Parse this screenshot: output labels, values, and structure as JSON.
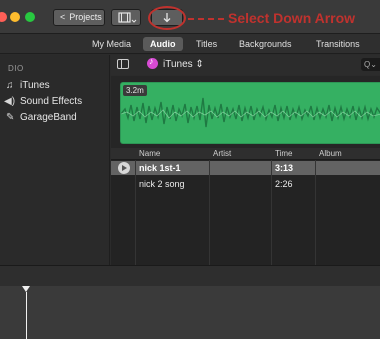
{
  "toolbar": {
    "projects_label": "Projects",
    "annotation_text": "Select Down Arrow"
  },
  "tabs": [
    {
      "label": "My Media"
    },
    {
      "label": "Audio"
    },
    {
      "label": "Titles"
    },
    {
      "label": "Backgrounds"
    },
    {
      "label": "Transitions"
    }
  ],
  "sidebar": {
    "heading": "DIO",
    "items": [
      {
        "label": "iTunes",
        "icon": "music-note-icon"
      },
      {
        "label": "Sound Effects",
        "icon": "speaker-icon"
      },
      {
        "label": "GarageBand",
        "icon": "guitar-icon"
      }
    ]
  },
  "browser": {
    "source_label": "iTunes ⇕",
    "search_glyph": "Q⌄",
    "clip_duration": "3.2m"
  },
  "table": {
    "headers": [
      "Name",
      "Artist",
      "Time",
      "Album"
    ],
    "rows": [
      {
        "name": "nick 1st-1",
        "artist": "",
        "time": "3:13",
        "album": "",
        "selected": true
      },
      {
        "name": "nick 2 song",
        "artist": "",
        "time": "2:26",
        "album": "",
        "selected": false
      }
    ]
  },
  "colors": {
    "waveform": "#35b062",
    "annotation": "#c0322e",
    "selected_row": "#636363"
  }
}
